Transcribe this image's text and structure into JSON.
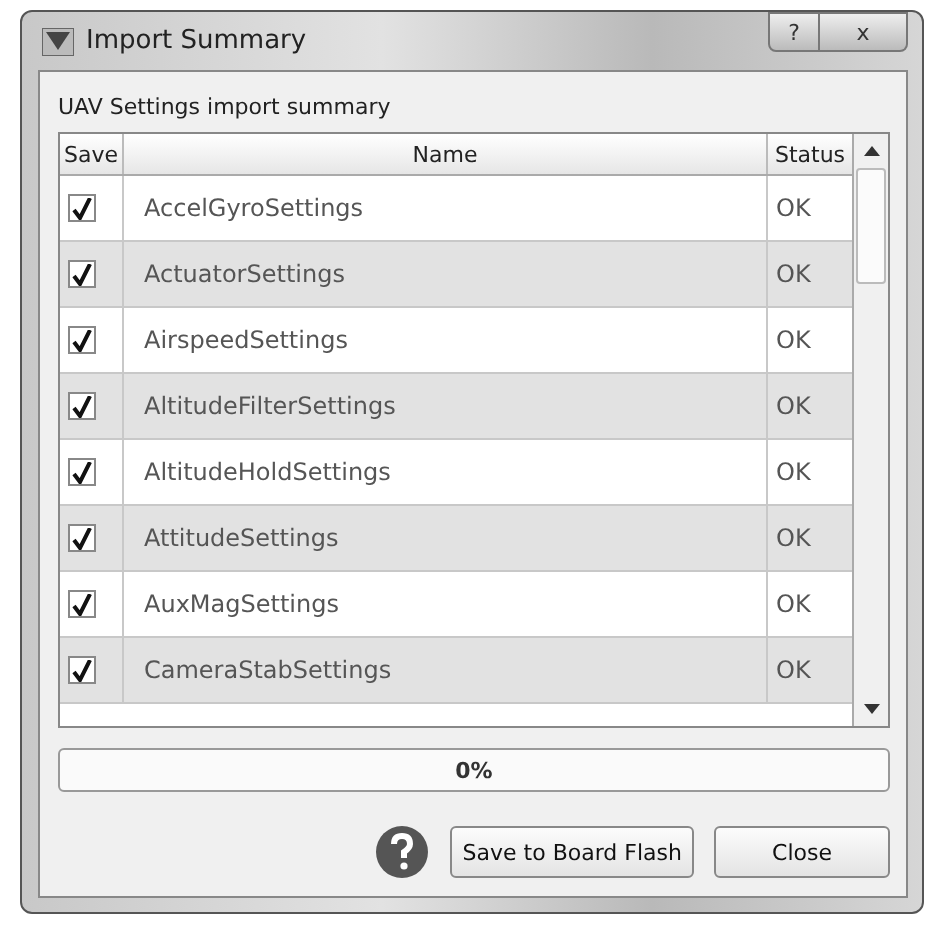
{
  "window": {
    "title": "Import Summary",
    "buttons": [
      "?",
      "x"
    ]
  },
  "summary_label": "UAV Settings import summary",
  "table": {
    "columns": [
      "Save",
      "Name",
      "Status"
    ],
    "rows": [
      {
        "save": true,
        "name": "AccelGyroSettings",
        "status": "OK"
      },
      {
        "save": true,
        "name": "ActuatorSettings",
        "status": "OK"
      },
      {
        "save": true,
        "name": "AirspeedSettings",
        "status": "OK"
      },
      {
        "save": true,
        "name": "AltitudeFilterSettings",
        "status": "OK"
      },
      {
        "save": true,
        "name": "AltitudeHoldSettings",
        "status": "OK"
      },
      {
        "save": true,
        "name": "AttitudeSettings",
        "status": "OK"
      },
      {
        "save": true,
        "name": "AuxMagSettings",
        "status": "OK"
      },
      {
        "save": true,
        "name": "CameraStabSettings",
        "status": "OK"
      }
    ]
  },
  "progress": {
    "level": 0,
    "text": "0%"
  },
  "buttons": [
    "Save to Board Flash",
    "Close"
  ]
}
